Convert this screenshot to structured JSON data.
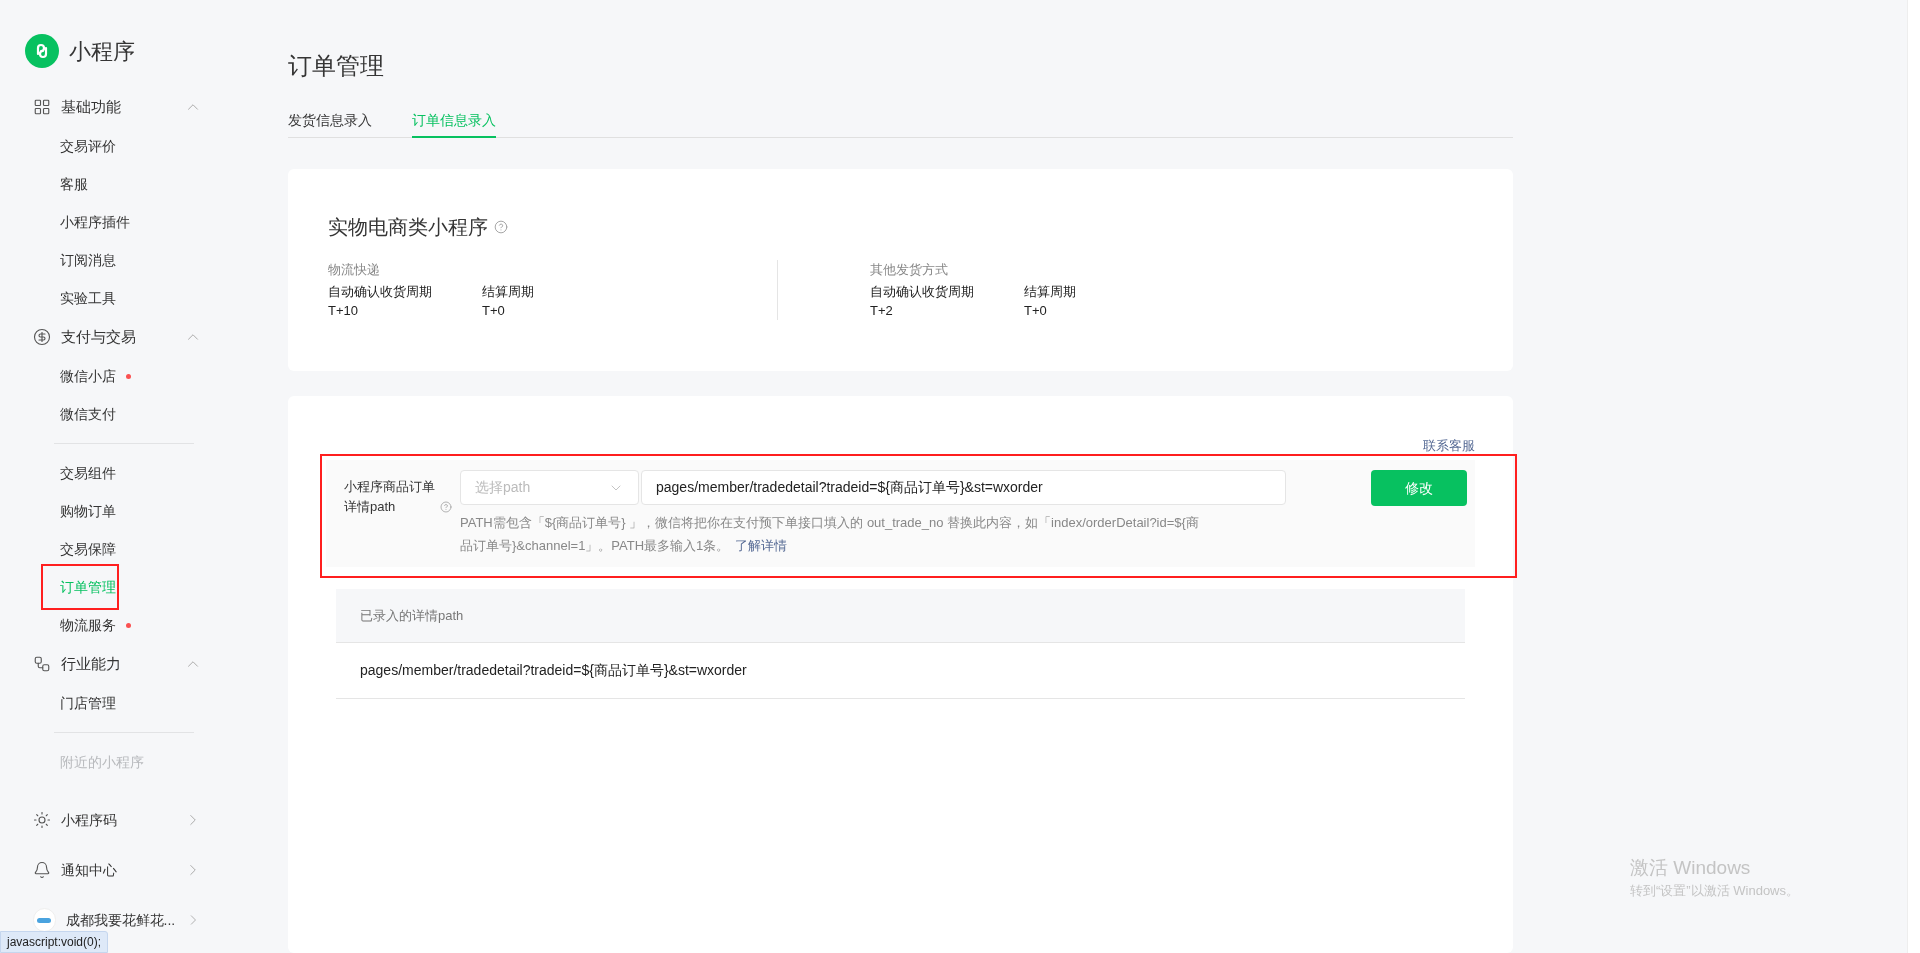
{
  "sidebar": {
    "logo_text": "小程序",
    "groups": [
      {
        "label": "基础功能",
        "kind": "grid",
        "expanded": true,
        "items": [
          {
            "label": "交易评价",
            "selected": false,
            "dot": false,
            "divider_before": false,
            "highlighted": false
          },
          {
            "label": "客服",
            "selected": false,
            "dot": false,
            "divider_before": false,
            "highlighted": false
          },
          {
            "label": "小程序插件",
            "selected": false,
            "dot": false,
            "divider_before": false,
            "highlighted": false
          },
          {
            "label": "订阅消息",
            "selected": false,
            "dot": false,
            "divider_before": false,
            "highlighted": false
          },
          {
            "label": "实验工具",
            "selected": false,
            "dot": false,
            "divider_before": false,
            "highlighted": false
          }
        ]
      },
      {
        "label": "支付与交易",
        "kind": "yen",
        "expanded": true,
        "items": [
          {
            "label": "微信小店",
            "selected": false,
            "dot": true,
            "divider_before": false,
            "highlighted": false
          },
          {
            "label": "微信支付",
            "selected": false,
            "dot": false,
            "divider_before": false,
            "highlighted": false
          },
          {
            "label": "交易组件",
            "selected": false,
            "dot": false,
            "divider_before": true,
            "highlighted": false
          },
          {
            "label": "购物订单",
            "selected": false,
            "dot": false,
            "divider_before": false,
            "highlighted": false
          },
          {
            "label": "交易保障",
            "selected": false,
            "dot": false,
            "divider_before": false,
            "highlighted": false
          },
          {
            "label": "订单管理",
            "selected": true,
            "dot": false,
            "divider_before": false,
            "highlighted": true
          },
          {
            "label": "物流服务",
            "selected": false,
            "dot": true,
            "divider_before": false,
            "highlighted": false
          }
        ]
      },
      {
        "label": "行业能力",
        "kind": "nodes",
        "expanded": true,
        "items": [
          {
            "label": "门店管理",
            "selected": false,
            "dot": false,
            "divider_before": false,
            "highlighted": false
          }
        ]
      }
    ],
    "faded_item": "附近的小程序",
    "links": [
      {
        "label": "小程序码",
        "kind": "qr"
      },
      {
        "label": "通知中心",
        "kind": "bell"
      },
      {
        "label": "成都我要花鲜花...",
        "kind": "account"
      }
    ]
  },
  "page_title": "订单管理",
  "tabs": [
    {
      "label": "发货信息录入",
      "selected": false
    },
    {
      "label": "订单信息录入",
      "selected": true
    }
  ],
  "summary": {
    "title": "实物电商类小程序",
    "columns": [
      {
        "heading": "物流快递",
        "fields": [
          {
            "label": "自动确认收货周期",
            "value": "T+10"
          },
          {
            "label": "结算周期",
            "value": "T+0"
          }
        ]
      },
      {
        "heading": "其他发货方式",
        "fields": [
          {
            "label": "自动确认收货周期",
            "value": "T+2"
          },
          {
            "label": "结算周期",
            "value": "T+0"
          }
        ]
      }
    ]
  },
  "path_form": {
    "contact_link": "联系客服",
    "highlighted": true,
    "label": "小程序商品订单详情path",
    "select_placeholder": "选择path",
    "path_value": "pages/member/tradedetail?tradeid=${商品订单号}&st=wxorder",
    "button": "修改",
    "help": "PATH需包含「${商品订单号} 」，微信将把你在支付预下单接口填入的 out_trade_no 替换此内容，如「index/orderDetail?id=${商品订单号}&channel=1」。PATH最多输入1条。",
    "help_link": "了解详情"
  },
  "path_table": {
    "header": "已录入的详情path",
    "rows": [
      "pages/member/tradedetail?tradeid=${商品订单号}&st=wxorder"
    ]
  },
  "os_notice": {
    "title": "激活 Windows",
    "text": "转到“设置”以激活 Windows。"
  },
  "status_bar": {
    "text": "javascript:void(0);"
  }
}
